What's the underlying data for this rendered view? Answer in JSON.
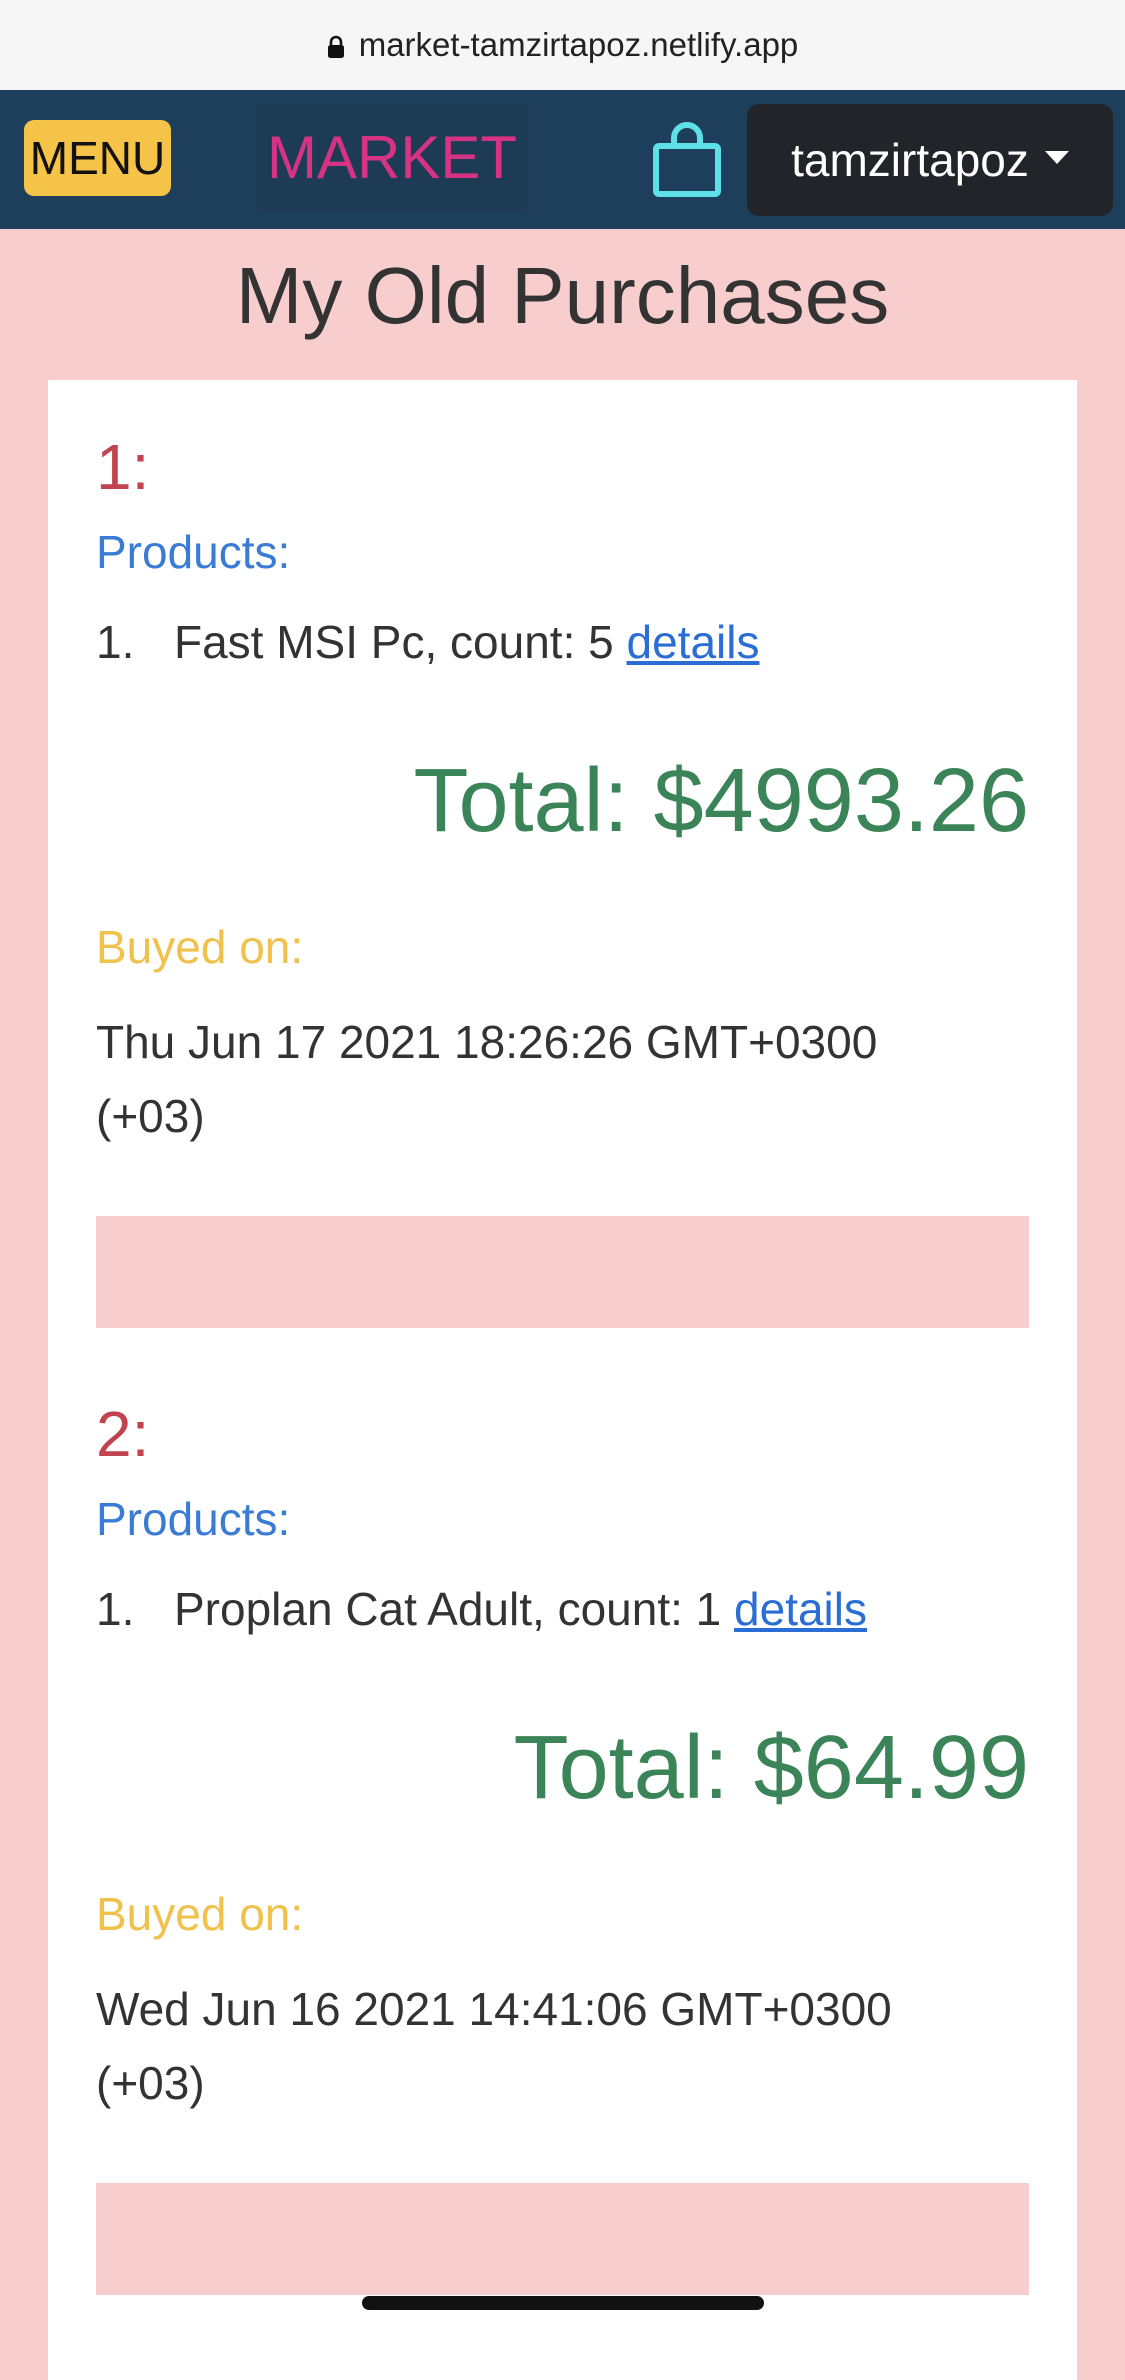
{
  "browser": {
    "url": "market-tamzirtapoz.netlify.app",
    "icon": "lock-icon"
  },
  "navbar": {
    "menu_label": "MENU",
    "brand": "MARKET",
    "cart_icon": "shopping-bag-icon",
    "username": "tamzirtapoz"
  },
  "page": {
    "title": "My Old Purchases"
  },
  "labels": {
    "products": "Products:",
    "buyed_on": "Buyed on:",
    "details": "details"
  },
  "orders": [
    {
      "number": "1:",
      "items": [
        {
          "index": "1.",
          "text": "Fast MSI Pc, count: 5"
        }
      ],
      "total": "Total: $4993.26",
      "date": "Thu Jun 17 2021 18:26:26 GMT+0300 (+03)"
    },
    {
      "number": "2:",
      "items": [
        {
          "index": "1.",
          "text": "Proplan Cat Adult, count: 1"
        }
      ],
      "total": "Total: $64.99",
      "date": "Wed Jun 16 2021 14:41:06 GMT+0300 (+03)"
    }
  ],
  "colors": {
    "navbar_bg": "#1d3f5c",
    "page_bg": "#f7cdcd",
    "menu_button": "#f5c347",
    "brand": "#d63384",
    "cart_icon": "#5ee0e8",
    "order_number": "#c0434f",
    "products_label": "#3a7bd5",
    "total": "#3a8458",
    "buyed_label": "#f0c14b"
  }
}
